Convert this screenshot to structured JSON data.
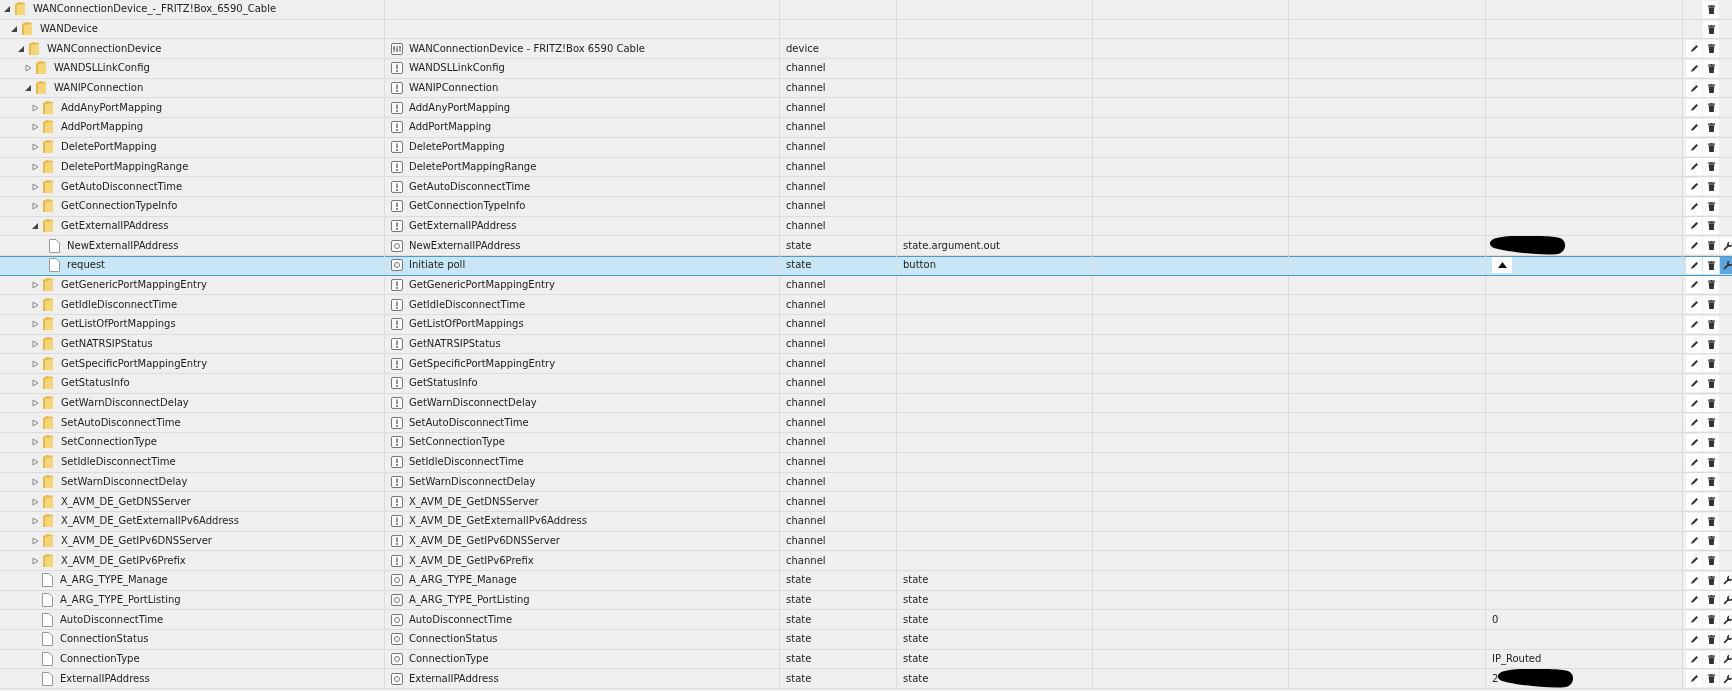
{
  "tree": [
    {
      "kind": "folder",
      "name": "WANConnectionDevice_-_FRITZ!Box_6590_Cable",
      "expanded": true,
      "selected": false,
      "children": [
        {
          "kind": "folder",
          "name": "WANDevice",
          "expanded": true,
          "selected": false,
          "children": [
            {
              "kind": "device",
              "name": "WANConnectionDevice",
              "title": "WANConnectionDevice - FRITZ!Box 6590 Cable",
              "type": "device",
              "expanded": true,
              "selected": false,
              "children": [
                {
                  "kind": "channel",
                  "name": "WANDSLLinkConfig",
                  "title": "WANDSLLinkConfig",
                  "type": "channel",
                  "expanded": false,
                  "selected": false
                },
                {
                  "kind": "channel",
                  "name": "WANIPConnection",
                  "title": "WANIPConnection",
                  "type": "channel",
                  "expanded": true,
                  "selected": false,
                  "children": [
                    {
                      "kind": "channel",
                      "name": "AddAnyPortMapping",
                      "title": "AddAnyPortMapping",
                      "type": "channel",
                      "expanded": false,
                      "selected": false
                    },
                    {
                      "kind": "channel",
                      "name": "AddPortMapping",
                      "title": "AddPortMapping",
                      "type": "channel",
                      "expanded": false,
                      "selected": false
                    },
                    {
                      "kind": "channel",
                      "name": "DeletePortMapping",
                      "title": "DeletePortMapping",
                      "type": "channel",
                      "expanded": false,
                      "selected": false
                    },
                    {
                      "kind": "channel",
                      "name": "DeletePortMappingRange",
                      "title": "DeletePortMappingRange",
                      "type": "channel",
                      "expanded": false,
                      "selected": false
                    },
                    {
                      "kind": "channel",
                      "name": "GetAutoDisconnectTime",
                      "title": "GetAutoDisconnectTime",
                      "type": "channel",
                      "expanded": false,
                      "selected": false
                    },
                    {
                      "kind": "channel",
                      "name": "GetConnectionTypeInfo",
                      "title": "GetConnectionTypeInfo",
                      "type": "channel",
                      "expanded": false,
                      "selected": false
                    },
                    {
                      "kind": "channel",
                      "name": "GetExternalIPAddress",
                      "title": "GetExternalIPAddress",
                      "type": "channel",
                      "expanded": true,
                      "selected": false,
                      "children": [
                        {
                          "kind": "state",
                          "name": "NewExternalIPAddress",
                          "title": "NewExternalIPAddress",
                          "type": "state",
                          "role": "state.argument.out",
                          "redacted": true,
                          "selected": false
                        },
                        {
                          "kind": "state",
                          "name": "request",
                          "title": "Initiate poll",
                          "type": "state",
                          "role": "button",
                          "value_button": true,
                          "selected": true
                        }
                      ]
                    },
                    {
                      "kind": "channel",
                      "name": "GetGenericPortMappingEntry",
                      "title": "GetGenericPortMappingEntry",
                      "type": "channel",
                      "expanded": false,
                      "selected": false
                    },
                    {
                      "kind": "channel",
                      "name": "GetIdleDisconnectTime",
                      "title": "GetIdleDisconnectTime",
                      "type": "channel",
                      "expanded": false,
                      "selected": false
                    },
                    {
                      "kind": "channel",
                      "name": "GetListOfPortMappings",
                      "title": "GetListOfPortMappings",
                      "type": "channel",
                      "expanded": false,
                      "selected": false
                    },
                    {
                      "kind": "channel",
                      "name": "GetNATRSIPStatus",
                      "title": "GetNATRSIPStatus",
                      "type": "channel",
                      "expanded": false,
                      "selected": false
                    },
                    {
                      "kind": "channel",
                      "name": "GetSpecificPortMappingEntry",
                      "title": "GetSpecificPortMappingEntry",
                      "type": "channel",
                      "expanded": false,
                      "selected": false
                    },
                    {
                      "kind": "channel",
                      "name": "GetStatusInfo",
                      "title": "GetStatusInfo",
                      "type": "channel",
                      "expanded": false,
                      "selected": false
                    },
                    {
                      "kind": "channel",
                      "name": "GetWarnDisconnectDelay",
                      "title": "GetWarnDisconnectDelay",
                      "type": "channel",
                      "expanded": false,
                      "selected": false
                    },
                    {
                      "kind": "channel",
                      "name": "SetAutoDisconnectTime",
                      "title": "SetAutoDisconnectTime",
                      "type": "channel",
                      "expanded": false,
                      "selected": false
                    },
                    {
                      "kind": "channel",
                      "name": "SetConnectionType",
                      "title": "SetConnectionType",
                      "type": "channel",
                      "expanded": false,
                      "selected": false
                    },
                    {
                      "kind": "channel",
                      "name": "SetIdleDisconnectTime",
                      "title": "SetIdleDisconnectTime",
                      "type": "channel",
                      "expanded": false,
                      "selected": false
                    },
                    {
                      "kind": "channel",
                      "name": "SetWarnDisconnectDelay",
                      "title": "SetWarnDisconnectDelay",
                      "type": "channel",
                      "expanded": false,
                      "selected": false
                    },
                    {
                      "kind": "channel",
                      "name": "X_AVM_DE_GetDNSServer",
                      "title": "X_AVM_DE_GetDNSServer",
                      "type": "channel",
                      "expanded": false,
                      "selected": false
                    },
                    {
                      "kind": "channel",
                      "name": "X_AVM_DE_GetExternalIPv6Address",
                      "title": "X_AVM_DE_GetExternalIPv6Address",
                      "type": "channel",
                      "expanded": false,
                      "selected": false
                    },
                    {
                      "kind": "channel",
                      "name": "X_AVM_DE_GetIPv6DNSServer",
                      "title": "X_AVM_DE_GetIPv6DNSServer",
                      "type": "channel",
                      "expanded": false,
                      "selected": false
                    },
                    {
                      "kind": "channel",
                      "name": "X_AVM_DE_GetIPv6Prefix",
                      "title": "X_AVM_DE_GetIPv6Prefix",
                      "type": "channel",
                      "expanded": false,
                      "selected": false
                    },
                    {
                      "kind": "state",
                      "name": "A_ARG_TYPE_Manage",
                      "title": "A_ARG_TYPE_Manage",
                      "type": "state",
                      "role": "state",
                      "selected": false
                    },
                    {
                      "kind": "state",
                      "name": "A_ARG_TYPE_PortListing",
                      "title": "A_ARG_TYPE_PortListing",
                      "type": "state",
                      "role": "state",
                      "selected": false
                    },
                    {
                      "kind": "state",
                      "name": "AutoDisconnectTime",
                      "title": "AutoDisconnectTime",
                      "type": "state",
                      "role": "state",
                      "value": "0",
                      "selected": false
                    },
                    {
                      "kind": "state",
                      "name": "ConnectionStatus",
                      "title": "ConnectionStatus",
                      "type": "state",
                      "role": "state",
                      "selected": false
                    },
                    {
                      "kind": "state",
                      "name": "ConnectionType",
                      "title": "ConnectionType",
                      "type": "state",
                      "role": "state",
                      "value": "IP_Routed",
                      "selected": false
                    },
                    {
                      "kind": "state",
                      "name": "ExternalIPAddress",
                      "title": "ExternalIPAddress",
                      "type": "state",
                      "role": "state",
                      "value": "2",
                      "redacted": true,
                      "selected": false
                    }
                  ]
                }
              ]
            }
          ]
        }
      ]
    }
  ]
}
